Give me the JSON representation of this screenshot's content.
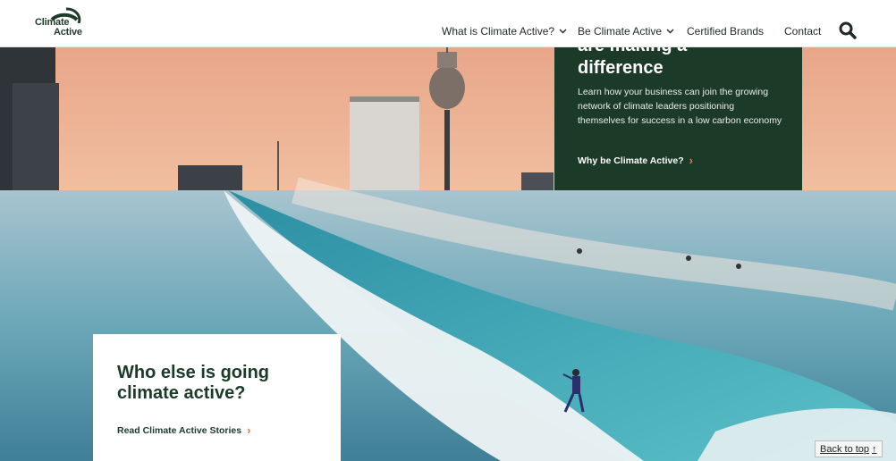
{
  "header": {
    "logo": {
      "line1": "Climate",
      "line2": "Active"
    },
    "nav": [
      {
        "label": "What is Climate Active?",
        "has_dropdown": true
      },
      {
        "label": "Be Climate Active",
        "has_dropdown": true
      },
      {
        "label": "Certified Brands",
        "has_dropdown": false
      },
      {
        "label": "Contact",
        "has_dropdown": false
      }
    ],
    "search_icon": "search-icon"
  },
  "hero": {
    "image": "Sydney skyline with Sydney Tower above a breaking ocean wave with surfers",
    "green_card": {
      "heading_line1": "are making a",
      "heading_line2": "difference",
      "body": "Learn how your business can join the growing network of climate leaders positioning themselves for success in a low carbon economy",
      "link": "Why be Climate Active?"
    },
    "white_card": {
      "heading": "Who else is going climate active?",
      "link": "Read Climate Active Stories"
    }
  },
  "back_to_top": {
    "label": "Back to top",
    "icon": "arrow-up-icon"
  },
  "colors": {
    "brand_green": "#1b3a28",
    "accent_coral": "#e07a5f",
    "sky": "#e9a78a",
    "ocean": "#5fb3c2"
  }
}
